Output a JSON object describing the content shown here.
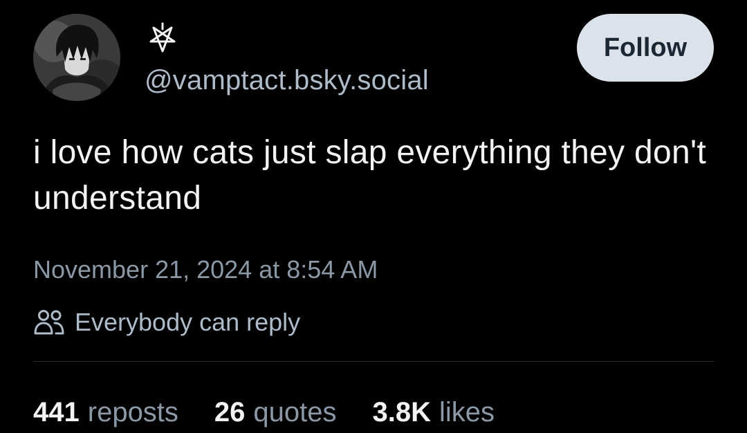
{
  "author": {
    "handle": "@vamptact.bsky.social",
    "avatar_icon": "anime-avatar-icon",
    "display_name_icon": "pentagram-icon"
  },
  "follow_button": {
    "label": "Follow"
  },
  "post": {
    "text": "i love how cats just slap everything they don't understand",
    "timestamp": "November 21, 2024 at 8:54 AM"
  },
  "reply_settings": {
    "icon": "people-icon",
    "label": "Everybody can reply"
  },
  "stats": {
    "reposts": {
      "count": "441",
      "label": "reposts"
    },
    "quotes": {
      "count": "26",
      "label": "quotes"
    },
    "likes": {
      "count": "3.8K",
      "label": "likes"
    }
  },
  "colors": {
    "background": "#000000",
    "text_primary": "#f1f3f5",
    "text_secondary": "#8b98a5",
    "handle": "#aebbc9",
    "follow_button_bg": "#dce2ea",
    "follow_button_text": "#1b2733",
    "divider": "#26313c"
  }
}
